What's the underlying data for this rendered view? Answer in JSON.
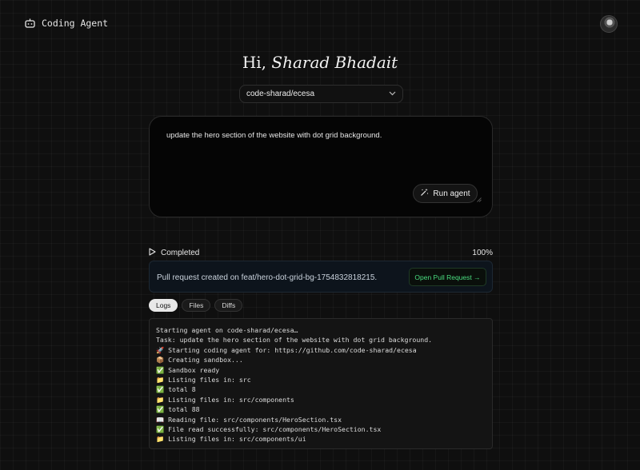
{
  "header": {
    "brand": "Coding Agent",
    "brand_icon": "robot-icon"
  },
  "greeting": {
    "prefix": "Hi,",
    "name": "Sharad Bhadait"
  },
  "repo_select": {
    "value": "code-sharad/ecesa"
  },
  "prompt": {
    "text": "update the hero section of the website with dot grid background.",
    "run_label": "Run agent"
  },
  "status": {
    "label": "Completed",
    "progress": "100%"
  },
  "pull_request": {
    "message": "Pull request created on feat/hero-dot-grid-bg-1754832818215.",
    "button_label": "Open Pull Request →"
  },
  "tabs": [
    {
      "label": "Logs"
    },
    {
      "label": "Files"
    },
    {
      "label": "Diffs"
    }
  ],
  "logs": [
    "Starting agent on code-sharad/ecesa…",
    "Task: update the hero section of the website with dot grid background.",
    "🚀 Starting coding agent for: https://github.com/code-sharad/ecesa",
    "📦 Creating sandbox...",
    "✅ Sandbox ready",
    "📁 Listing files in: src",
    "✅ total 8",
    "📁 Listing files in: src/components",
    "✅ total 88",
    "📖 Reading file: src/components/HeroSection.tsx",
    "✅ File read successfully: src/components/HeroSection.tsx",
    "📁 Listing files in: src/components/ui"
  ],
  "colors": {
    "background": "#0f0f0f",
    "accent_green": "#4ade80",
    "banner_bg": "#0d141c"
  }
}
